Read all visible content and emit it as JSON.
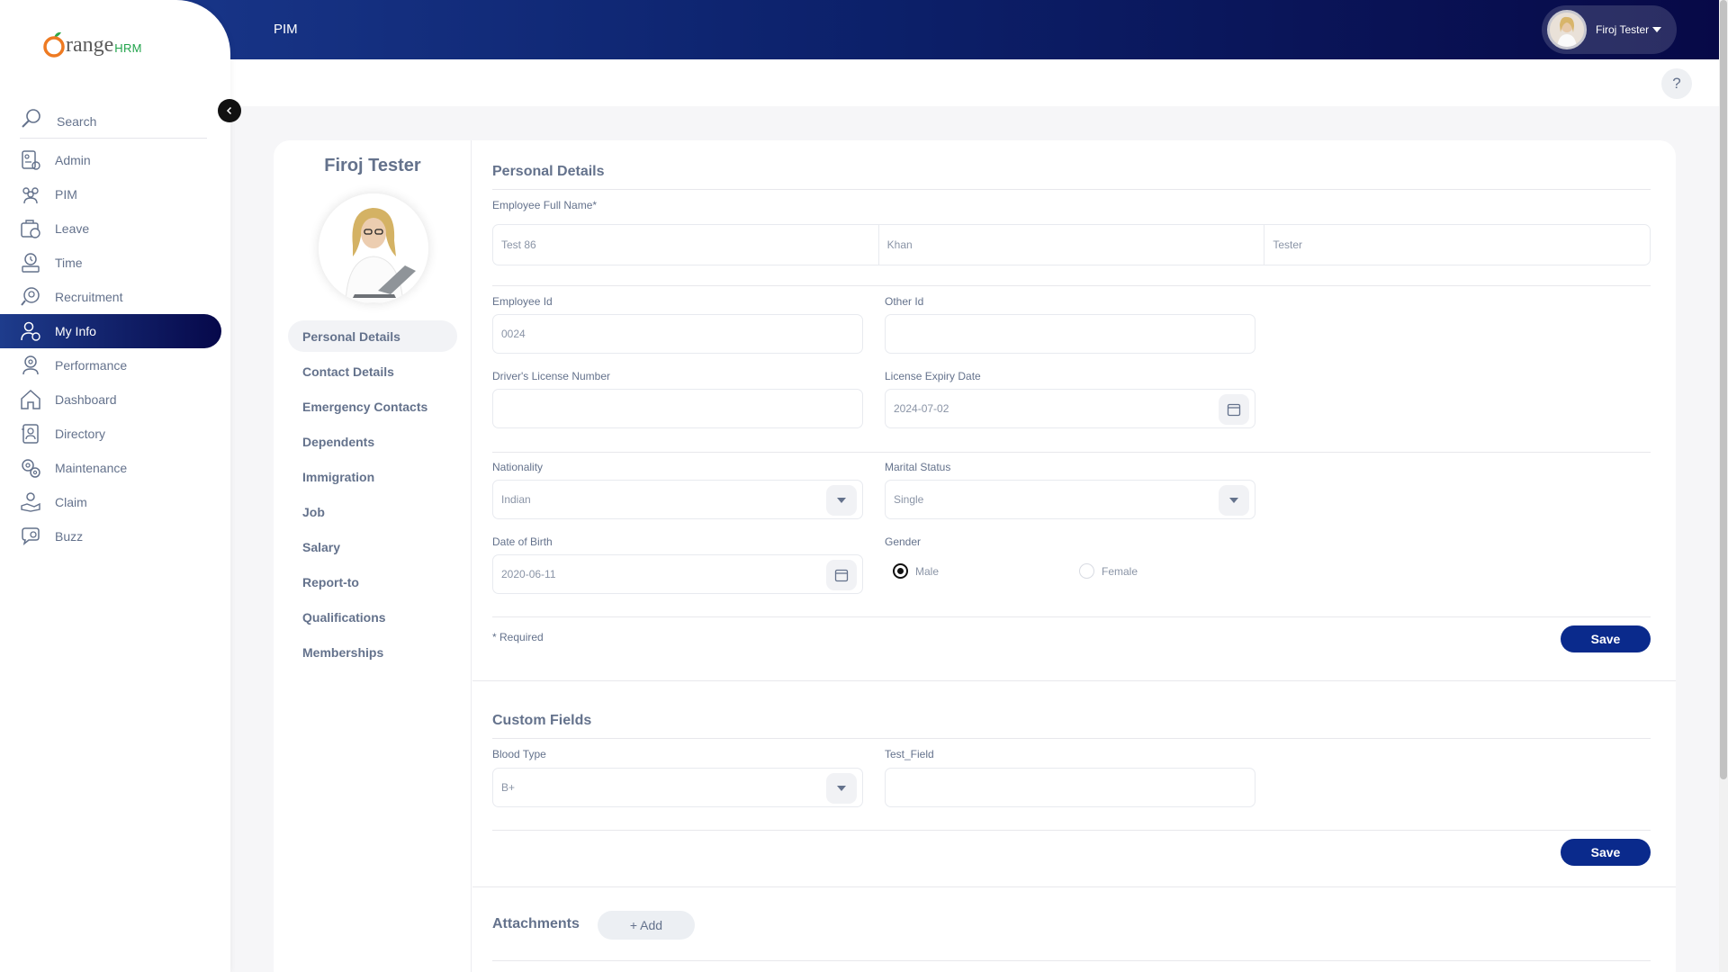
{
  "colors": {
    "accent": "#0a2a8c",
    "topbar": "#0d236e",
    "orange": "#ee7a22",
    "green": "#20a34a"
  },
  "brand": {
    "orange": "range",
    "hrm": "HRM"
  },
  "sidebar": {
    "search_label": "Search",
    "collapse_icon": "chevron-left-icon",
    "items": [
      {
        "label": "Admin",
        "icon": "admin-icon"
      },
      {
        "label": "PIM",
        "icon": "pim-icon"
      },
      {
        "label": "Leave",
        "icon": "leave-icon"
      },
      {
        "label": "Time",
        "icon": "time-icon"
      },
      {
        "label": "Recruitment",
        "icon": "recruitment-icon"
      },
      {
        "label": "My Info",
        "icon": "my-info-icon",
        "active": true
      },
      {
        "label": "Performance",
        "icon": "performance-icon"
      },
      {
        "label": "Dashboard",
        "icon": "dashboard-icon"
      },
      {
        "label": "Directory",
        "icon": "directory-icon"
      },
      {
        "label": "Maintenance",
        "icon": "maintenance-icon"
      },
      {
        "label": "Claim",
        "icon": "claim-icon"
      },
      {
        "label": "Buzz",
        "icon": "buzz-icon"
      }
    ]
  },
  "header": {
    "title": "PIM",
    "user_name": "Firoj Tester",
    "help": "?"
  },
  "profile": {
    "name": "Firoj Tester",
    "tabs": [
      {
        "label": "Personal Details",
        "active": true
      },
      {
        "label": "Contact Details"
      },
      {
        "label": "Emergency Contacts"
      },
      {
        "label": "Dependents"
      },
      {
        "label": "Immigration"
      },
      {
        "label": "Job"
      },
      {
        "label": "Salary"
      },
      {
        "label": "Report-to"
      },
      {
        "label": "Qualifications"
      },
      {
        "label": "Memberships"
      }
    ]
  },
  "personal": {
    "title": "Personal Details",
    "full_name_label": "Employee Full Name*",
    "first_name": "Test 86",
    "middle_name": "Khan",
    "last_name": "Tester",
    "employee_id_label": "Employee Id",
    "employee_id": "0024",
    "other_id_label": "Other Id",
    "other_id": "",
    "license_label": "Driver's License Number",
    "license": "",
    "license_expiry_label": "License Expiry Date",
    "license_expiry": "2024-07-02",
    "nationality_label": "Nationality",
    "nationality": "Indian",
    "marital_label": "Marital Status",
    "marital": "Single",
    "dob_label": "Date of Birth",
    "dob": "2020-06-11",
    "gender_label": "Gender",
    "gender_options": [
      "Male",
      "Female"
    ],
    "gender_selected": "Male",
    "required_note": "* Required",
    "save_label": "Save"
  },
  "custom": {
    "title": "Custom Fields",
    "blood_type_label": "Blood Type",
    "blood_type": "B+",
    "test_field_label": "Test_Field",
    "test_field": "",
    "save_label": "Save"
  },
  "attachments": {
    "title": "Attachments",
    "add_label": "+ Add"
  }
}
